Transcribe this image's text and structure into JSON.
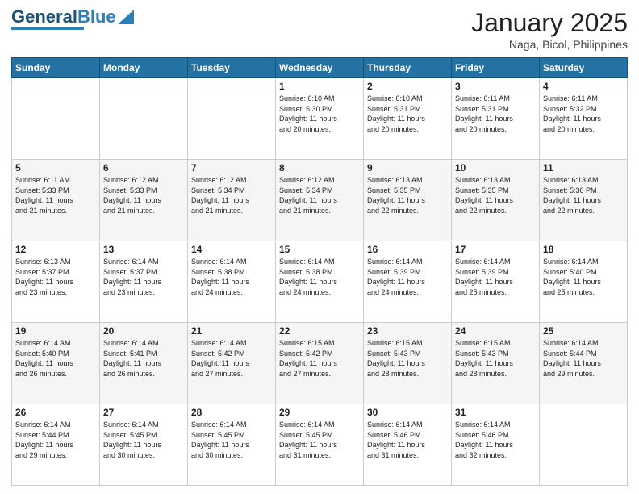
{
  "header": {
    "logo_text_general": "General",
    "logo_text_blue": "Blue",
    "month_title": "January 2025",
    "location": "Naga, Bicol, Philippines"
  },
  "days_of_week": [
    "Sunday",
    "Monday",
    "Tuesday",
    "Wednesday",
    "Thursday",
    "Friday",
    "Saturday"
  ],
  "weeks": [
    [
      {
        "day": "",
        "info": ""
      },
      {
        "day": "",
        "info": ""
      },
      {
        "day": "",
        "info": ""
      },
      {
        "day": "1",
        "info": "Sunrise: 6:10 AM\nSunset: 5:30 PM\nDaylight: 11 hours\nand 20 minutes."
      },
      {
        "day": "2",
        "info": "Sunrise: 6:10 AM\nSunset: 5:31 PM\nDaylight: 11 hours\nand 20 minutes."
      },
      {
        "day": "3",
        "info": "Sunrise: 6:11 AM\nSunset: 5:31 PM\nDaylight: 11 hours\nand 20 minutes."
      },
      {
        "day": "4",
        "info": "Sunrise: 6:11 AM\nSunset: 5:32 PM\nDaylight: 11 hours\nand 20 minutes."
      }
    ],
    [
      {
        "day": "5",
        "info": "Sunrise: 6:11 AM\nSunset: 5:33 PM\nDaylight: 11 hours\nand 21 minutes."
      },
      {
        "day": "6",
        "info": "Sunrise: 6:12 AM\nSunset: 5:33 PM\nDaylight: 11 hours\nand 21 minutes."
      },
      {
        "day": "7",
        "info": "Sunrise: 6:12 AM\nSunset: 5:34 PM\nDaylight: 11 hours\nand 21 minutes."
      },
      {
        "day": "8",
        "info": "Sunrise: 6:12 AM\nSunset: 5:34 PM\nDaylight: 11 hours\nand 21 minutes."
      },
      {
        "day": "9",
        "info": "Sunrise: 6:13 AM\nSunset: 5:35 PM\nDaylight: 11 hours\nand 22 minutes."
      },
      {
        "day": "10",
        "info": "Sunrise: 6:13 AM\nSunset: 5:35 PM\nDaylight: 11 hours\nand 22 minutes."
      },
      {
        "day": "11",
        "info": "Sunrise: 6:13 AM\nSunset: 5:36 PM\nDaylight: 11 hours\nand 22 minutes."
      }
    ],
    [
      {
        "day": "12",
        "info": "Sunrise: 6:13 AM\nSunset: 5:37 PM\nDaylight: 11 hours\nand 23 minutes."
      },
      {
        "day": "13",
        "info": "Sunrise: 6:14 AM\nSunset: 5:37 PM\nDaylight: 11 hours\nand 23 minutes."
      },
      {
        "day": "14",
        "info": "Sunrise: 6:14 AM\nSunset: 5:38 PM\nDaylight: 11 hours\nand 24 minutes."
      },
      {
        "day": "15",
        "info": "Sunrise: 6:14 AM\nSunset: 5:38 PM\nDaylight: 11 hours\nand 24 minutes."
      },
      {
        "day": "16",
        "info": "Sunrise: 6:14 AM\nSunset: 5:39 PM\nDaylight: 11 hours\nand 24 minutes."
      },
      {
        "day": "17",
        "info": "Sunrise: 6:14 AM\nSunset: 5:39 PM\nDaylight: 11 hours\nand 25 minutes."
      },
      {
        "day": "18",
        "info": "Sunrise: 6:14 AM\nSunset: 5:40 PM\nDaylight: 11 hours\nand 25 minutes."
      }
    ],
    [
      {
        "day": "19",
        "info": "Sunrise: 6:14 AM\nSunset: 5:40 PM\nDaylight: 11 hours\nand 26 minutes."
      },
      {
        "day": "20",
        "info": "Sunrise: 6:14 AM\nSunset: 5:41 PM\nDaylight: 11 hours\nand 26 minutes."
      },
      {
        "day": "21",
        "info": "Sunrise: 6:14 AM\nSunset: 5:42 PM\nDaylight: 11 hours\nand 27 minutes."
      },
      {
        "day": "22",
        "info": "Sunrise: 6:15 AM\nSunset: 5:42 PM\nDaylight: 11 hours\nand 27 minutes."
      },
      {
        "day": "23",
        "info": "Sunrise: 6:15 AM\nSunset: 5:43 PM\nDaylight: 11 hours\nand 28 minutes."
      },
      {
        "day": "24",
        "info": "Sunrise: 6:15 AM\nSunset: 5:43 PM\nDaylight: 11 hours\nand 28 minutes."
      },
      {
        "day": "25",
        "info": "Sunrise: 6:14 AM\nSunset: 5:44 PM\nDaylight: 11 hours\nand 29 minutes."
      }
    ],
    [
      {
        "day": "26",
        "info": "Sunrise: 6:14 AM\nSunset: 5:44 PM\nDaylight: 11 hours\nand 29 minutes."
      },
      {
        "day": "27",
        "info": "Sunrise: 6:14 AM\nSunset: 5:45 PM\nDaylight: 11 hours\nand 30 minutes."
      },
      {
        "day": "28",
        "info": "Sunrise: 6:14 AM\nSunset: 5:45 PM\nDaylight: 11 hours\nand 30 minutes."
      },
      {
        "day": "29",
        "info": "Sunrise: 6:14 AM\nSunset: 5:45 PM\nDaylight: 11 hours\nand 31 minutes."
      },
      {
        "day": "30",
        "info": "Sunrise: 6:14 AM\nSunset: 5:46 PM\nDaylight: 11 hours\nand 31 minutes."
      },
      {
        "day": "31",
        "info": "Sunrise: 6:14 AM\nSunset: 5:46 PM\nDaylight: 11 hours\nand 32 minutes."
      },
      {
        "day": "",
        "info": ""
      }
    ]
  ]
}
